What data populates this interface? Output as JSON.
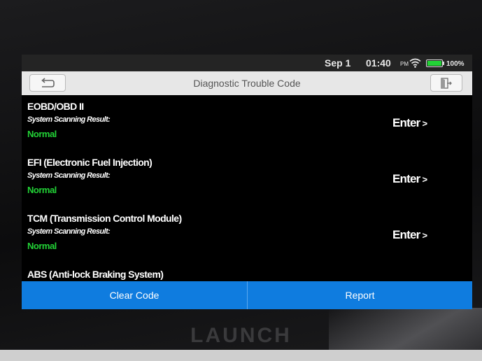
{
  "status_bar": {
    "date": "Sep 1",
    "time": "01:40",
    "ampm": "PM",
    "battery": "100%",
    "battery_color": "#22d236"
  },
  "header": {
    "title": "Diagnostic Trouble Code",
    "back_icon": "back-arrow-icon",
    "exit_icon": "exit-door-icon"
  },
  "systems": [
    {
      "name": "EOBD/OBD II",
      "subtitle": "System Scanning Result:",
      "status": "Normal",
      "action": "Enter"
    },
    {
      "name": "EFI (Electronic Fuel Injection)",
      "subtitle": "System Scanning Result:",
      "status": "Normal",
      "action": "Enter"
    },
    {
      "name": "TCM (Transmission Control Module)",
      "subtitle": "System Scanning Result:",
      "status": "Normal",
      "action": "Enter"
    },
    {
      "name": "ABS (Anti-lock Braking System)"
    }
  ],
  "footer": {
    "clear_code": "Clear Code",
    "report": "Report"
  },
  "brand": "LAUNCH",
  "colors": {
    "accent": "#0f7cdf",
    "status_ok": "#22d236"
  }
}
